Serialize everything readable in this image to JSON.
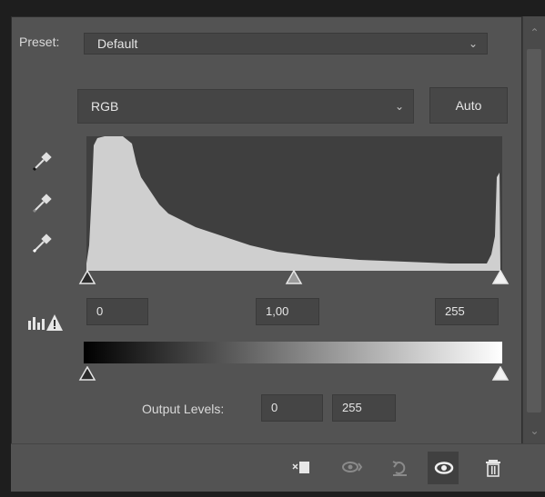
{
  "preset": {
    "label": "Preset:",
    "value": "Default"
  },
  "channel": {
    "value": "RGB"
  },
  "auto_button": {
    "label": "Auto"
  },
  "input_levels": {
    "black": "0",
    "gamma": "1,00",
    "white": "255"
  },
  "output_levels": {
    "label": "Output Levels:",
    "black": "0",
    "white": "255"
  },
  "icons": {
    "eyedroppers": [
      "black-point-eyedropper-icon",
      "gray-point-eyedropper-icon",
      "white-point-eyedropper-icon"
    ],
    "warning": "histogram-warning-icon",
    "bottom_tools": [
      "clip-to-layer-icon",
      "view-previous-state-icon",
      "reset-icon",
      "toggle-visibility-icon",
      "delete-icon"
    ]
  },
  "colors": {
    "panel": "#535353",
    "input": "#454545",
    "histogram": "#cfcfcf"
  }
}
